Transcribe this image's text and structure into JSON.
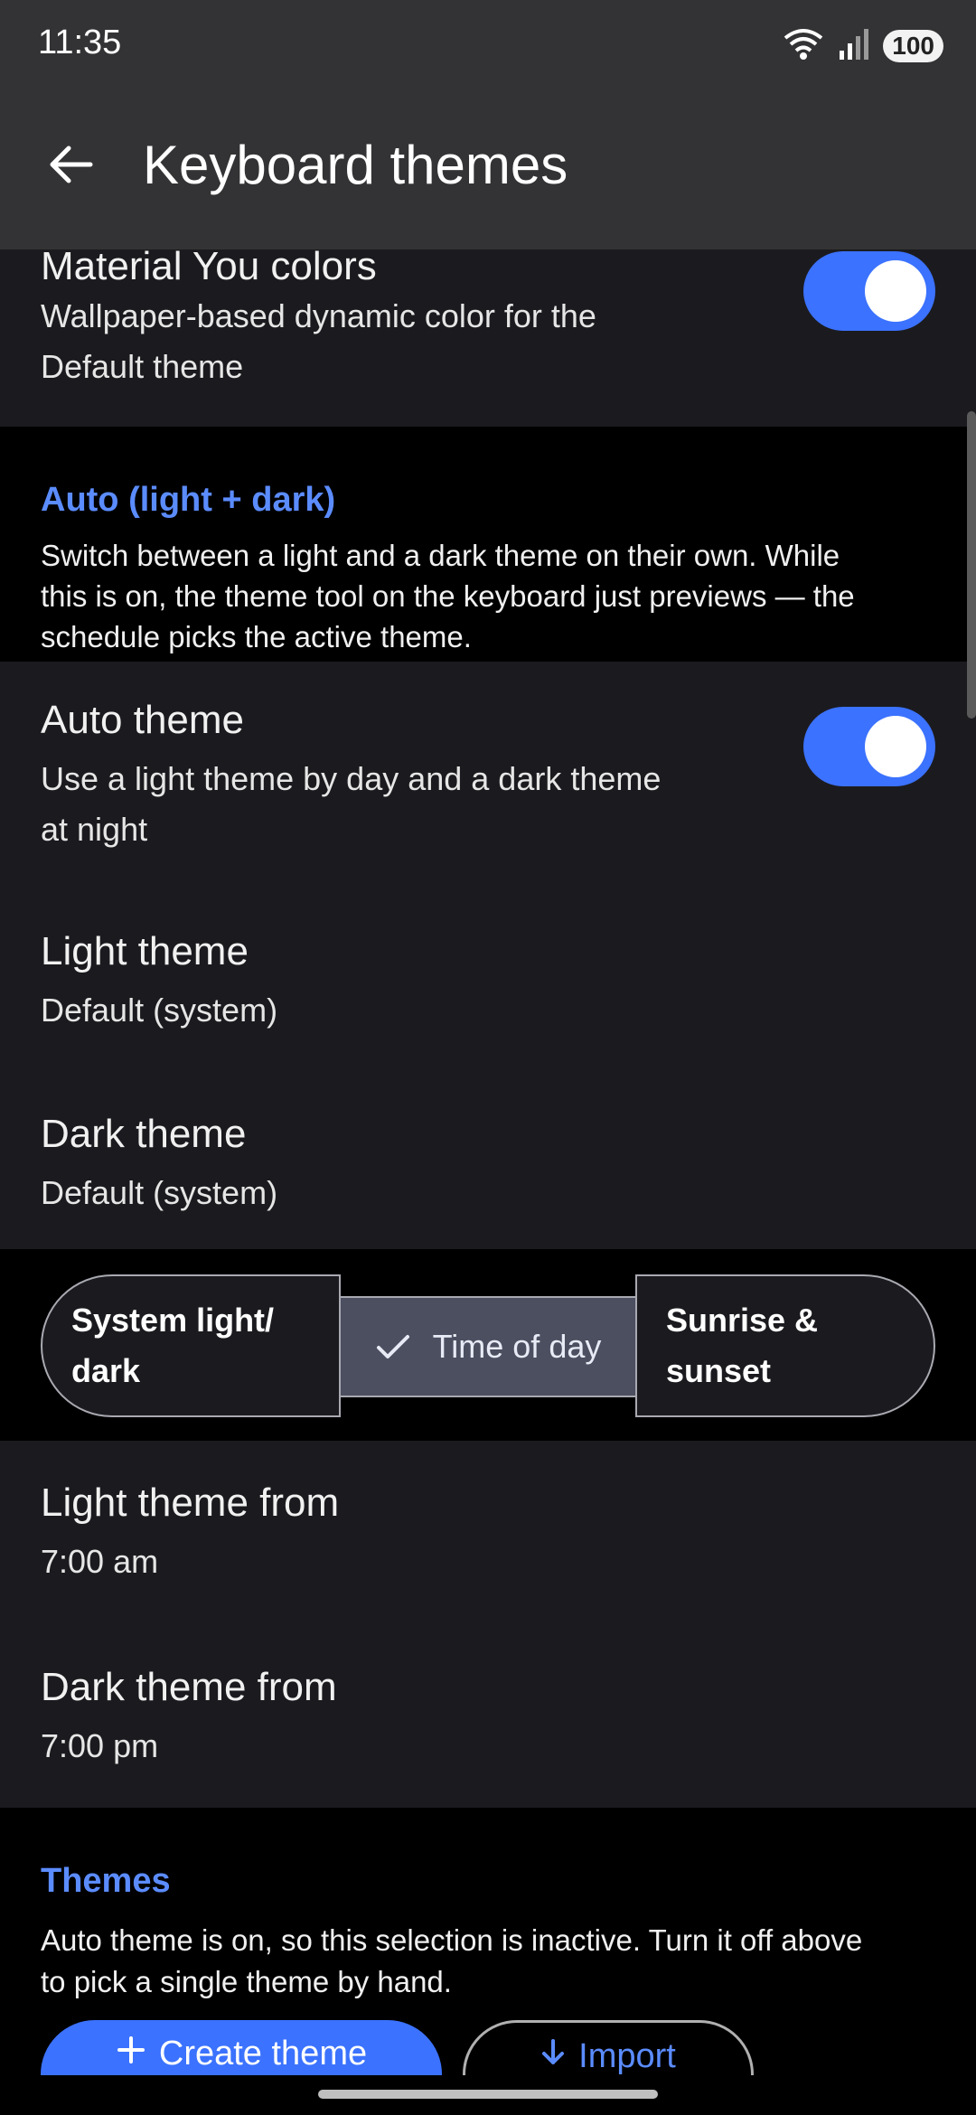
{
  "status_bar": {
    "time": "11:35",
    "battery": "100"
  },
  "app_bar": {
    "title": "Keyboard themes"
  },
  "material_you": {
    "title": "Material You colors",
    "subtitle_line1": "Wallpaper-based dynamic color for the",
    "subtitle_line2": "Default theme",
    "enabled": true
  },
  "auto_section": {
    "header": "Auto (light + dark)",
    "desc_line1": "Switch between a light and a dark theme on their own. While",
    "desc_line2": "this is on, the theme tool on the keyboard just previews — the",
    "desc_line3": "schedule picks the active theme."
  },
  "auto_theme": {
    "title": "Auto theme",
    "subtitle_line1": "Use a light theme by day and a dark theme",
    "subtitle_line2": "at night",
    "enabled": true
  },
  "light_theme": {
    "title": "Light theme",
    "value": "Default (system)"
  },
  "dark_theme": {
    "title": "Dark theme",
    "value": "Default (system)"
  },
  "schedule_mode": {
    "options": [
      {
        "line1": "System light/",
        "line2": "dark"
      },
      {
        "label": "Time of day"
      },
      {
        "line1": "Sunrise &",
        "line2": "sunset"
      }
    ],
    "selected": "Time of day"
  },
  "light_from": {
    "title": "Light theme from",
    "value": "7:00 am"
  },
  "dark_from": {
    "title": "Dark theme from",
    "value": "7:00 pm"
  },
  "themes_section": {
    "header": "Themes",
    "desc_line1": "Auto theme is on, so this selection is inactive. Turn it off above",
    "desc_line2": "to pick a single theme by hand."
  },
  "buttons": {
    "create": "Create theme",
    "import": "Import"
  },
  "colors": {
    "accent": "#3b72ff",
    "header_text": "#5b8cff",
    "card_bg": "#1b1b1f",
    "app_bar_bg": "#333335"
  },
  "icons": [
    "arrow-back-icon",
    "wifi-icon",
    "signal-icon",
    "check-icon",
    "plus-icon",
    "download-icon"
  ]
}
